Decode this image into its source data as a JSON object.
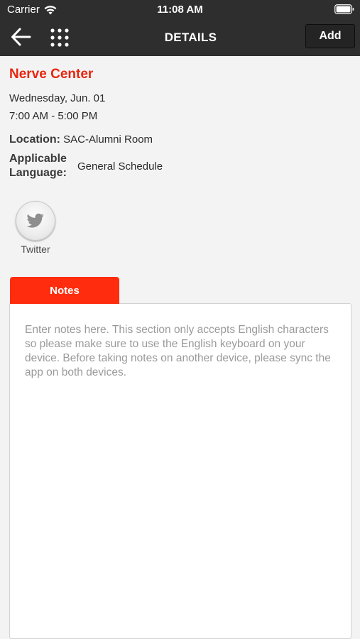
{
  "status_bar": {
    "carrier": "Carrier",
    "time": "11:08 AM",
    "wifi_icon": "wifi-icon",
    "battery_icon": "battery-icon"
  },
  "nav": {
    "back_icon": "arrow-left-icon",
    "menu_icon": "grid-menu-icon",
    "title": "DETAILS",
    "add_label": "Add"
  },
  "event": {
    "title": "Nerve Center",
    "date": "Wednesday, Jun. 01",
    "time": "7:00 AM - 5:00 PM",
    "location_label": "Location:",
    "location_value": "SAC-Alumni Room",
    "language_label": "Applicable Language:",
    "language_value": "General Schedule"
  },
  "share": {
    "twitter_label": "Twitter",
    "twitter_icon": "twitter-bird-icon"
  },
  "notes": {
    "tab_label": "Notes",
    "value": "",
    "placeholder": "Enter notes here. This section only accepts English characters so please make sure to use the English keyboard on your device. Before taking notes on another device, please sync the app on both devices."
  },
  "colors": {
    "accent": "#e8260f",
    "tab": "#ff2d0d",
    "header": "#2e2e2e",
    "background": "#f3f3f3"
  }
}
